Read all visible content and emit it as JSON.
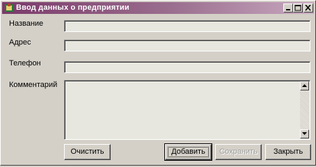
{
  "window": {
    "title": "Ввод данных о предприятии"
  },
  "form": {
    "name_label": "Название",
    "address_label": "Адрес",
    "phone_label": "Телефон",
    "comment_label": "Комментарий",
    "name_value": "",
    "address_value": "",
    "phone_value": "",
    "comment_value": ""
  },
  "buttons": {
    "clear": "Очистить",
    "add": "Добавить",
    "save": "Сохранить",
    "close": "Закрыть"
  }
}
